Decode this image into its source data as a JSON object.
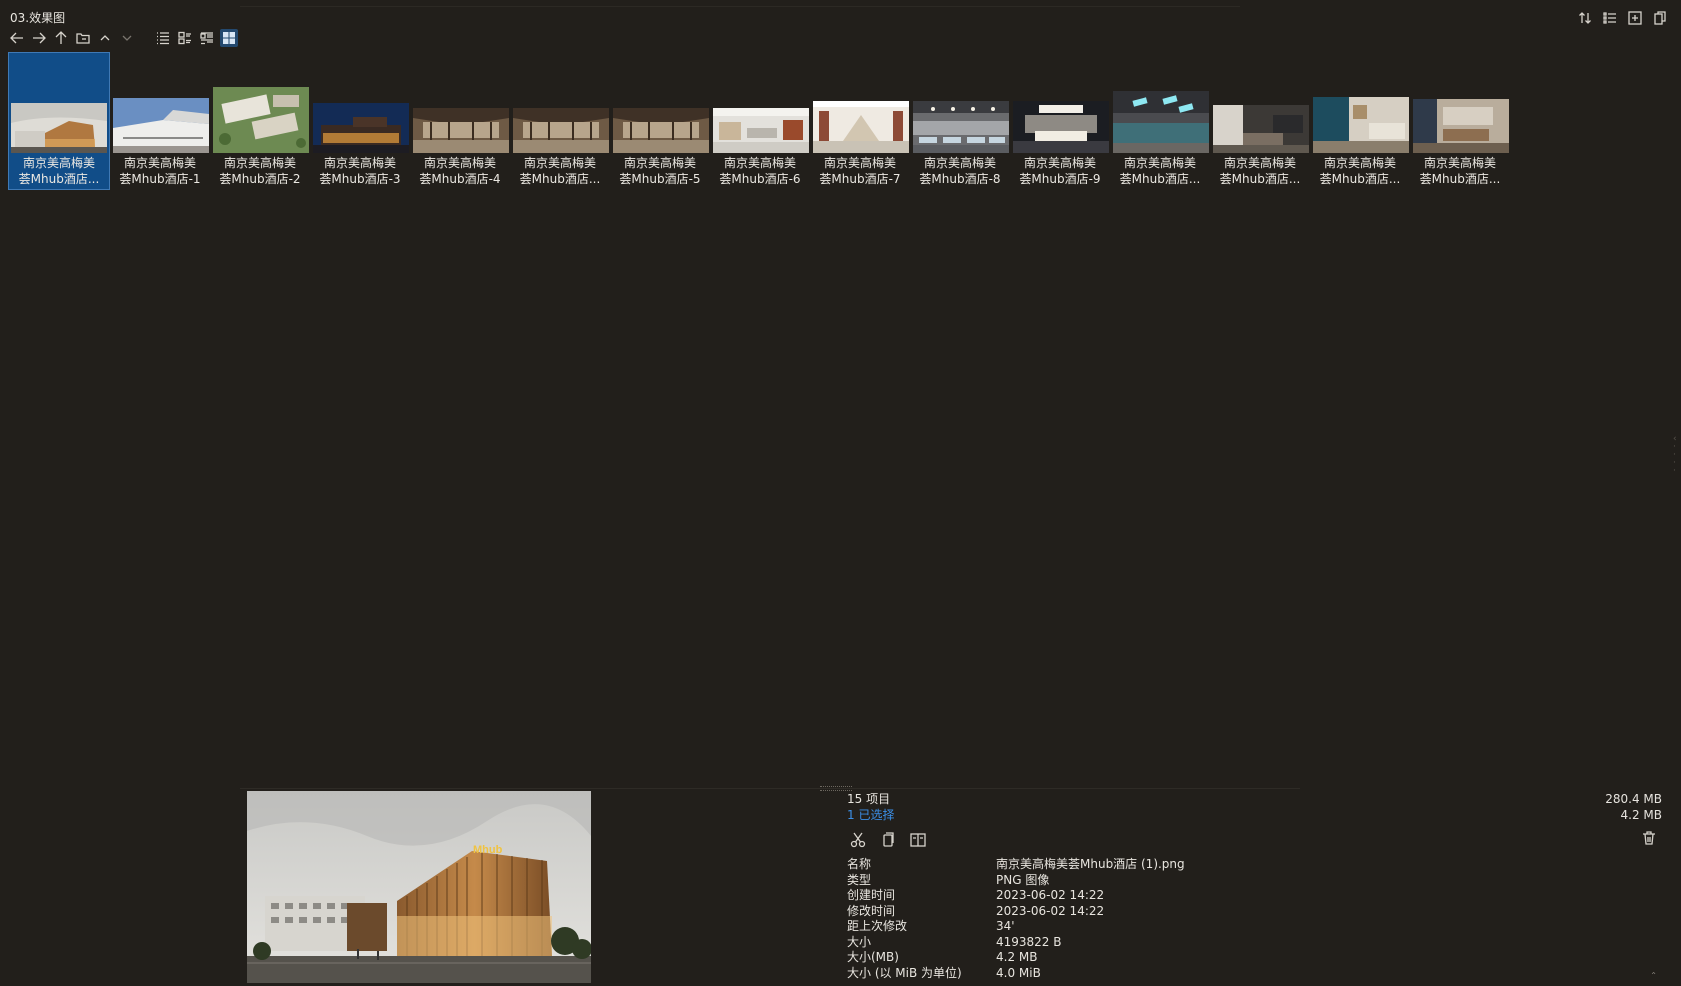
{
  "window": {
    "title": "03.效果图"
  },
  "toolbar": {
    "nav_icons": [
      "arrow-left-icon",
      "arrow-right-icon",
      "arrow-up-icon",
      "folder-icon",
      "chevron-up-icon",
      "chevron-down-icon"
    ],
    "view_icons": [
      "list-view-icon",
      "details-view-icon",
      "tiles-view-icon",
      "thumbnails-view-icon"
    ],
    "right_icons": [
      "sort-icon",
      "checklist-icon",
      "new-tab-icon",
      "clipboard-icon"
    ]
  },
  "files": [
    {
      "line1": "南京美高梅美",
      "line2": "荟Mhub酒店...",
      "selected": true,
      "scene": "exterior-day"
    },
    {
      "line1": "南京美高梅美",
      "line2": "荟Mhub酒店-1",
      "scene": "exterior-white"
    },
    {
      "line1": "南京美高梅美",
      "line2": "荟Mhub酒店-2",
      "scene": "aerial"
    },
    {
      "line1": "南京美高梅美",
      "line2": "荟Mhub酒店-3",
      "scene": "exterior-night"
    },
    {
      "line1": "南京美高梅美",
      "line2": "荟Mhub酒店-4",
      "scene": "lobby-wood"
    },
    {
      "line1": "南京美高梅美",
      "line2": "荟Mhub酒店...",
      "scene": "lobby-wood"
    },
    {
      "line1": "南京美高梅美",
      "line2": "荟Mhub酒店-5",
      "scene": "lobby-wood"
    },
    {
      "line1": "南京美高梅美",
      "line2": "荟Mhub酒店-6",
      "scene": "lobby-light"
    },
    {
      "line1": "南京美高梅美",
      "line2": "荟Mhub酒店-7",
      "scene": "atrium"
    },
    {
      "line1": "南京美高梅美",
      "line2": "荟Mhub酒店-8",
      "scene": "ballroom"
    },
    {
      "line1": "南京美高梅美",
      "line2": "荟Mhub酒店-9",
      "scene": "meeting"
    },
    {
      "line1": "南京美高梅美",
      "line2": "荟Mhub酒店...",
      "scene": "pool"
    },
    {
      "line1": "南京美高梅美",
      "line2": "荟Mhub酒店...",
      "scene": "room-dark"
    },
    {
      "line1": "南京美高梅美",
      "line2": "荟Mhub酒店...",
      "scene": "room-blue"
    },
    {
      "line1": "南京美高梅美",
      "line2": "荟Mhub酒店...",
      "scene": "room-warm"
    }
  ],
  "status": {
    "count": "15 项目",
    "selected": "1 已选择",
    "total_size": "280.4 MB",
    "selected_size": "4.2 MB"
  },
  "details": {
    "action_icons": [
      "cut-icon",
      "copy-icon",
      "open-with-icon"
    ],
    "rows": [
      {
        "k": "名称",
        "v": "南京美高梅美荟Mhub酒店 (1).png"
      },
      {
        "k": "类型",
        "v": "PNG 图像"
      },
      {
        "k": "创建时间",
        "v": "2023-06-02  14:22"
      },
      {
        "k": "修改时间",
        "v": "2023-06-02  14:22"
      },
      {
        "k": "距上次修改",
        "v": "34'"
      },
      {
        "k": "大小",
        "v": "4193822 B"
      },
      {
        "k": "大小(MB)",
        "v": "4.2 MB"
      },
      {
        "k": "大小 (以 MiB 为单位)",
        "v": "4.0 MiB"
      }
    ]
  },
  "preview": {
    "sign": "Mhub"
  },
  "colors": {
    "background": "#221f1b",
    "selection": "#114d88",
    "link": "#3b8ee6"
  }
}
